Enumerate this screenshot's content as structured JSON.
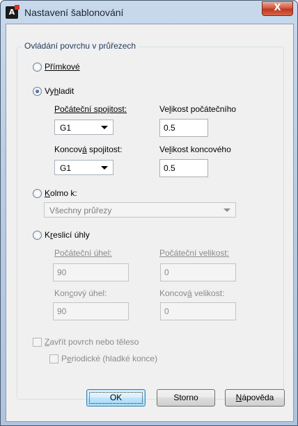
{
  "window": {
    "title": "Nastavení šablonování",
    "close_glyph": "X"
  },
  "group": {
    "title": "Ovládání povrchu v průřezech",
    "ruled": {
      "label": "Přímkové",
      "checked": false
    },
    "smooth": {
      "pre": "Vy",
      "u": "h",
      "post": "ladit",
      "checked": true,
      "start_continuity": {
        "pre": "Počáteční spojitost:",
        "value": "G1"
      },
      "start_magnitude": {
        "pre": "Ve",
        "u": "l",
        "post": "ikost počátečního",
        "value": "0.5"
      },
      "end_continuity": {
        "pre": "Koncov",
        "u": "á",
        "post": " spojitost:",
        "value": "G1"
      },
      "end_magnitude": {
        "pre": "Ve",
        "u": "l",
        "post": "ikost koncového",
        "value": "0.5"
      }
    },
    "normal": {
      "pre": "",
      "u": "K",
      "post": "olmo k:",
      "checked": false,
      "combo_value": "Všechny průřezy"
    },
    "draft": {
      "pre": "K",
      "u": "r",
      "post": "eslicí úhly",
      "checked": false,
      "start_angle": {
        "label": "Počáteční úhel:",
        "value": "90"
      },
      "start_magnitude": {
        "label": "Počáteční velikost:",
        "value": "0"
      },
      "end_angle": {
        "pre": "Kon",
        "u": "c",
        "post": "ový úhel:",
        "value": "90"
      },
      "end_magnitude": {
        "pre": "Koncov",
        "u": "á",
        "post": " velikost:",
        "value": "0"
      }
    },
    "close_surface": {
      "pre": "",
      "u": "Z",
      "post": "avřít povrch nebo těleso",
      "checked": false
    },
    "periodic": {
      "pre": "P",
      "u": "e",
      "post": "riodické (hladké konce)",
      "checked": false
    }
  },
  "buttons": {
    "ok": "OK",
    "cancel": "Storno",
    "help_u": "N",
    "help_post": "ápověda"
  }
}
